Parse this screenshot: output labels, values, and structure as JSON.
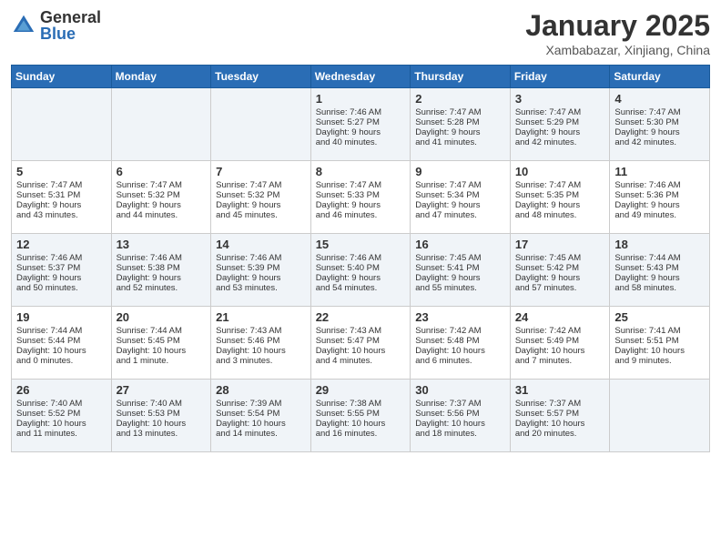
{
  "logo": {
    "general": "General",
    "blue": "Blue"
  },
  "header": {
    "title": "January 2025",
    "subtitle": "Xambabazar, Xinjiang, China"
  },
  "weekdays": [
    "Sunday",
    "Monday",
    "Tuesday",
    "Wednesday",
    "Thursday",
    "Friday",
    "Saturday"
  ],
  "weeks": [
    [
      {
        "day": "",
        "content": ""
      },
      {
        "day": "",
        "content": ""
      },
      {
        "day": "",
        "content": ""
      },
      {
        "day": "1",
        "content": "Sunrise: 7:46 AM\nSunset: 5:27 PM\nDaylight: 9 hours\nand 40 minutes."
      },
      {
        "day": "2",
        "content": "Sunrise: 7:47 AM\nSunset: 5:28 PM\nDaylight: 9 hours\nand 41 minutes."
      },
      {
        "day": "3",
        "content": "Sunrise: 7:47 AM\nSunset: 5:29 PM\nDaylight: 9 hours\nand 42 minutes."
      },
      {
        "day": "4",
        "content": "Sunrise: 7:47 AM\nSunset: 5:30 PM\nDaylight: 9 hours\nand 42 minutes."
      }
    ],
    [
      {
        "day": "5",
        "content": "Sunrise: 7:47 AM\nSunset: 5:31 PM\nDaylight: 9 hours\nand 43 minutes."
      },
      {
        "day": "6",
        "content": "Sunrise: 7:47 AM\nSunset: 5:32 PM\nDaylight: 9 hours\nand 44 minutes."
      },
      {
        "day": "7",
        "content": "Sunrise: 7:47 AM\nSunset: 5:32 PM\nDaylight: 9 hours\nand 45 minutes."
      },
      {
        "day": "8",
        "content": "Sunrise: 7:47 AM\nSunset: 5:33 PM\nDaylight: 9 hours\nand 46 minutes."
      },
      {
        "day": "9",
        "content": "Sunrise: 7:47 AM\nSunset: 5:34 PM\nDaylight: 9 hours\nand 47 minutes."
      },
      {
        "day": "10",
        "content": "Sunrise: 7:47 AM\nSunset: 5:35 PM\nDaylight: 9 hours\nand 48 minutes."
      },
      {
        "day": "11",
        "content": "Sunrise: 7:46 AM\nSunset: 5:36 PM\nDaylight: 9 hours\nand 49 minutes."
      }
    ],
    [
      {
        "day": "12",
        "content": "Sunrise: 7:46 AM\nSunset: 5:37 PM\nDaylight: 9 hours\nand 50 minutes."
      },
      {
        "day": "13",
        "content": "Sunrise: 7:46 AM\nSunset: 5:38 PM\nDaylight: 9 hours\nand 52 minutes."
      },
      {
        "day": "14",
        "content": "Sunrise: 7:46 AM\nSunset: 5:39 PM\nDaylight: 9 hours\nand 53 minutes."
      },
      {
        "day": "15",
        "content": "Sunrise: 7:46 AM\nSunset: 5:40 PM\nDaylight: 9 hours\nand 54 minutes."
      },
      {
        "day": "16",
        "content": "Sunrise: 7:45 AM\nSunset: 5:41 PM\nDaylight: 9 hours\nand 55 minutes."
      },
      {
        "day": "17",
        "content": "Sunrise: 7:45 AM\nSunset: 5:42 PM\nDaylight: 9 hours\nand 57 minutes."
      },
      {
        "day": "18",
        "content": "Sunrise: 7:44 AM\nSunset: 5:43 PM\nDaylight: 9 hours\nand 58 minutes."
      }
    ],
    [
      {
        "day": "19",
        "content": "Sunrise: 7:44 AM\nSunset: 5:44 PM\nDaylight: 10 hours\nand 0 minutes."
      },
      {
        "day": "20",
        "content": "Sunrise: 7:44 AM\nSunset: 5:45 PM\nDaylight: 10 hours\nand 1 minute."
      },
      {
        "day": "21",
        "content": "Sunrise: 7:43 AM\nSunset: 5:46 PM\nDaylight: 10 hours\nand 3 minutes."
      },
      {
        "day": "22",
        "content": "Sunrise: 7:43 AM\nSunset: 5:47 PM\nDaylight: 10 hours\nand 4 minutes."
      },
      {
        "day": "23",
        "content": "Sunrise: 7:42 AM\nSunset: 5:48 PM\nDaylight: 10 hours\nand 6 minutes."
      },
      {
        "day": "24",
        "content": "Sunrise: 7:42 AM\nSunset: 5:49 PM\nDaylight: 10 hours\nand 7 minutes."
      },
      {
        "day": "25",
        "content": "Sunrise: 7:41 AM\nSunset: 5:51 PM\nDaylight: 10 hours\nand 9 minutes."
      }
    ],
    [
      {
        "day": "26",
        "content": "Sunrise: 7:40 AM\nSunset: 5:52 PM\nDaylight: 10 hours\nand 11 minutes."
      },
      {
        "day": "27",
        "content": "Sunrise: 7:40 AM\nSunset: 5:53 PM\nDaylight: 10 hours\nand 13 minutes."
      },
      {
        "day": "28",
        "content": "Sunrise: 7:39 AM\nSunset: 5:54 PM\nDaylight: 10 hours\nand 14 minutes."
      },
      {
        "day": "29",
        "content": "Sunrise: 7:38 AM\nSunset: 5:55 PM\nDaylight: 10 hours\nand 16 minutes."
      },
      {
        "day": "30",
        "content": "Sunrise: 7:37 AM\nSunset: 5:56 PM\nDaylight: 10 hours\nand 18 minutes."
      },
      {
        "day": "31",
        "content": "Sunrise: 7:37 AM\nSunset: 5:57 PM\nDaylight: 10 hours\nand 20 minutes."
      },
      {
        "day": "",
        "content": ""
      }
    ]
  ]
}
